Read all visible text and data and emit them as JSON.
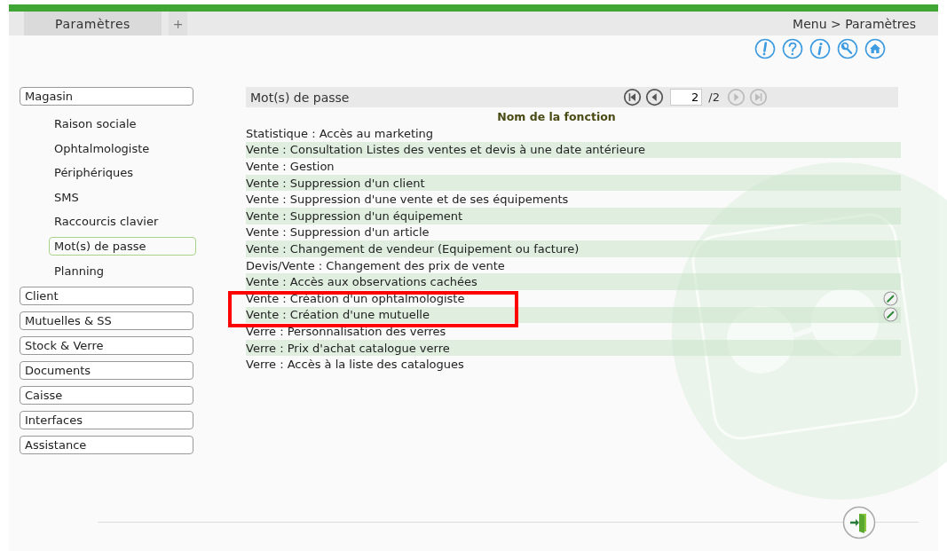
{
  "tabs": [
    {
      "label": "Paramètres",
      "selected": true
    }
  ],
  "add_tab": "+",
  "breadcrumb": "Menu > Paramètres",
  "toolbar_icons": [
    {
      "kind": "alert"
    },
    {
      "kind": "help"
    },
    {
      "kind": "info"
    },
    {
      "kind": "settings"
    },
    {
      "kind": "home"
    }
  ],
  "sidebar": {
    "items": [
      {
        "label": "Magasin",
        "children": [
          {
            "label": "Raison sociale",
            "selected": false
          },
          {
            "label": "Ophtalmologiste",
            "selected": false
          },
          {
            "label": "Périphériques",
            "selected": false
          },
          {
            "label": "SMS",
            "selected": false
          },
          {
            "label": "Raccourcis clavier",
            "selected": false
          },
          {
            "label": "Mot(s) de passe",
            "selected": true
          },
          {
            "label": "Planning",
            "selected": false
          }
        ]
      },
      {
        "label": "Client"
      },
      {
        "label": "Mutuelles & SS"
      },
      {
        "label": "Stock & Verre"
      },
      {
        "label": "Documents"
      },
      {
        "label": "Caisse"
      },
      {
        "label": "Interfaces"
      },
      {
        "label": "Assistance"
      }
    ]
  },
  "panel": {
    "title": "Mot(s) de passe",
    "pager": {
      "buttons": [
        {
          "kind": "first",
          "disabled": false
        },
        {
          "kind": "prev",
          "disabled": false
        },
        {
          "kind": "next",
          "disabled": true
        },
        {
          "kind": "last",
          "disabled": true
        }
      ],
      "page": "2",
      "total": "/2"
    },
    "column": "Nom de la fonction",
    "rows": [
      {
        "text": "Statistique : Accès au marketing",
        "editable": false,
        "highlighted": false
      },
      {
        "text": "Vente : Consultation Listes des ventes et devis à une date antérieure",
        "editable": false,
        "highlighted": false
      },
      {
        "text": "Vente : Gestion",
        "editable": false,
        "highlighted": false
      },
      {
        "text": "Vente : Suppression d'un client",
        "editable": false,
        "highlighted": false
      },
      {
        "text": "Vente : Suppression d'une vente et de ses équipements",
        "editable": false,
        "highlighted": false
      },
      {
        "text": "Vente : Suppression d'un équipement",
        "editable": false,
        "highlighted": false
      },
      {
        "text": "Vente : Suppression d'un article",
        "editable": false,
        "highlighted": false
      },
      {
        "text": "Vente : Changement de vendeur (Equipement ou facture)",
        "editable": false,
        "highlighted": false
      },
      {
        "text": "Devis/Vente : Changement des prix de vente",
        "editable": false,
        "highlighted": false
      },
      {
        "text": "Vente : Accès aux observations cachées",
        "editable": false,
        "highlighted": false
      },
      {
        "text": "Vente : Création d'un ophtalmologiste",
        "editable": true,
        "highlighted": true
      },
      {
        "text": "Vente : Création d'une mutuelle",
        "editable": true,
        "highlighted": true
      },
      {
        "text": "Verre : Personnalisation des verres",
        "editable": false,
        "highlighted": false
      },
      {
        "text": "Verre : Prix d'achat catalogue verre",
        "editable": false,
        "highlighted": false
      },
      {
        "text": "Verre : Accès à la liste des catalogues",
        "editable": false,
        "highlighted": false
      }
    ]
  }
}
